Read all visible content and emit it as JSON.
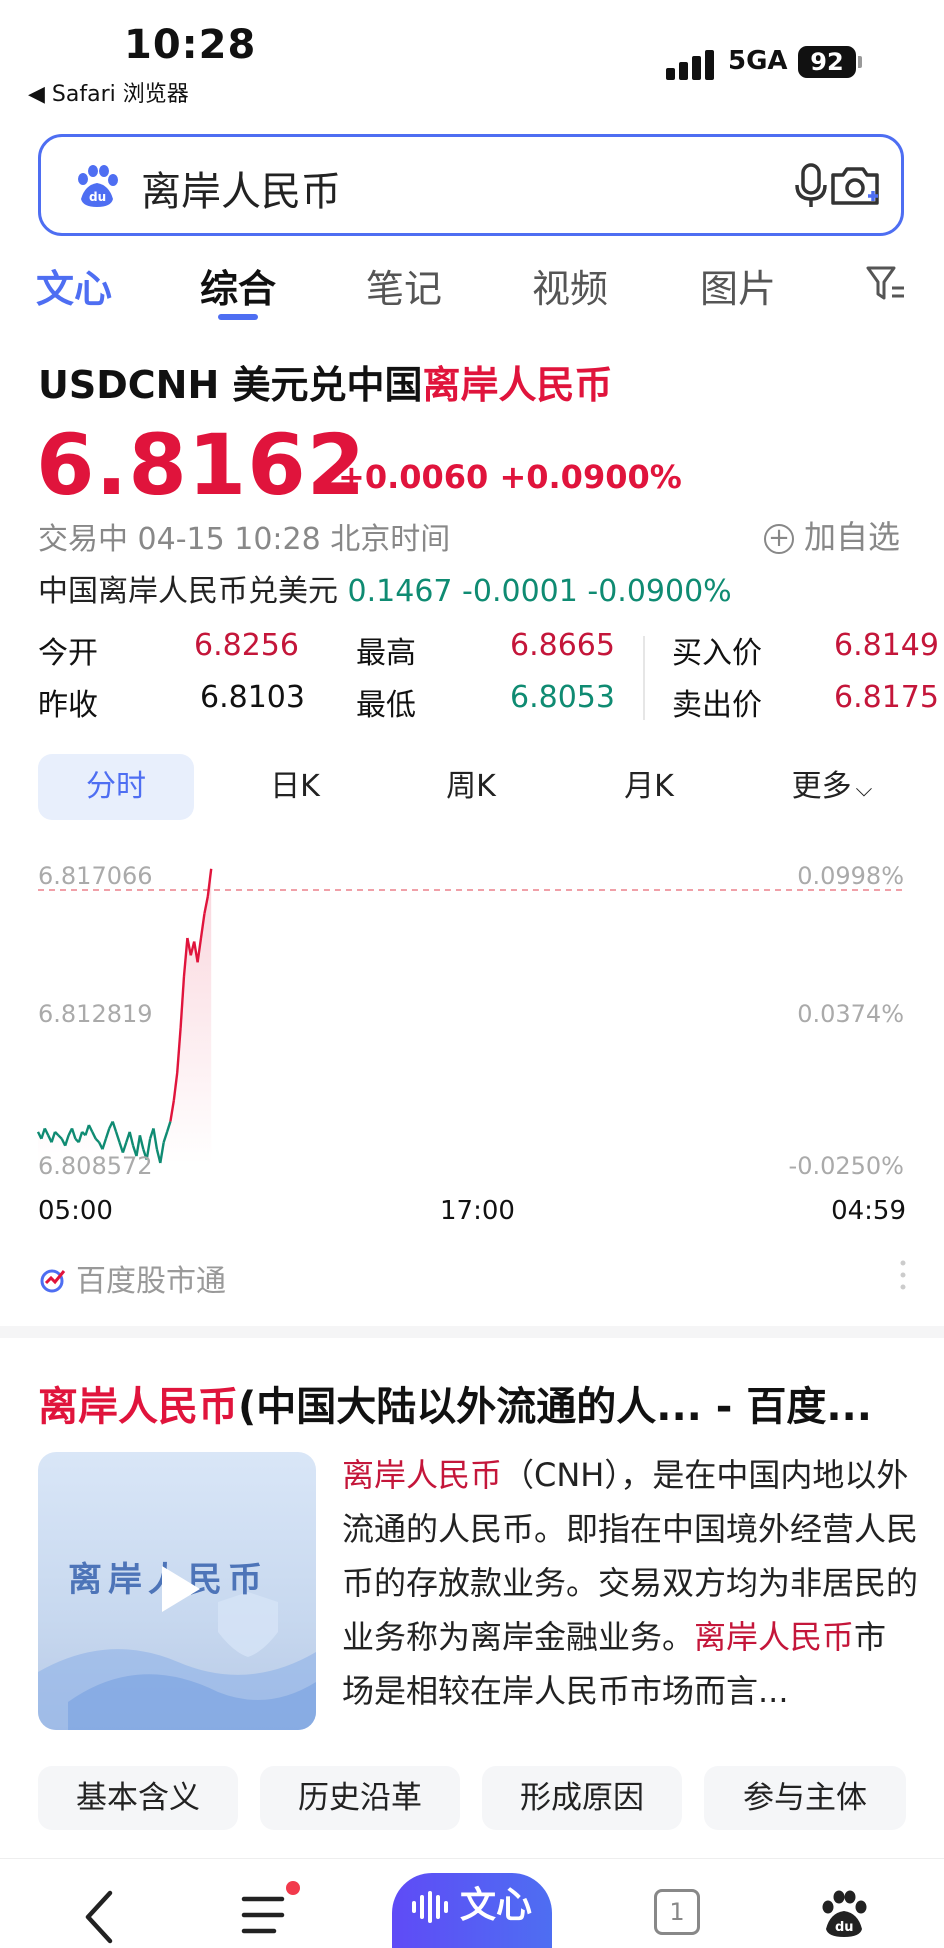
{
  "status_bar": {
    "time": "10:28",
    "back_app": "◀ Safari 浏览器",
    "network": "5GA",
    "battery": "92"
  },
  "search": {
    "query": "离岸人民币"
  },
  "tabs": [
    "文心",
    "综合",
    "笔记",
    "视频",
    "图片"
  ],
  "quote": {
    "title_prefix": "USDCNH 美元兑中国",
    "title_highlight": "离岸人民币",
    "price": "6.8162",
    "change": "+0.0060 +0.0900%",
    "trade_status": "交易中 04-15 10:28 北京时间",
    "add_watch": "加自选",
    "inverse_label": "中国离岸人民币兑美元",
    "inverse_values": "0.1467 -0.0001 -0.0900%",
    "stats": {
      "open_label": "今开",
      "open": "6.8256",
      "prev_label": "昨收",
      "prev": "6.8103",
      "high_label": "最高",
      "high": "6.8665",
      "low_label": "最低",
      "low": "6.8053",
      "bid_label": "买入价",
      "bid": "6.8149",
      "ask_label": "卖出价",
      "ask": "6.8175"
    }
  },
  "chart_tabs": [
    "分时",
    "日K",
    "周K",
    "月K",
    "更多"
  ],
  "chart_data": {
    "type": "line",
    "title": "",
    "ylabels_left": [
      "6.817066",
      "6.812819",
      "6.808572"
    ],
    "ylabels_right": [
      "0.0998%",
      "0.0374%",
      "-0.0250%"
    ],
    "xlabels": [
      "05:00",
      "17:00",
      "04:59"
    ],
    "ylim": [
      6.808572,
      6.817066
    ],
    "reference_price": 6.8103,
    "series": [
      {
        "values": [
          6.8095,
          6.8093,
          6.8096,
          6.8094,
          6.8092,
          6.8095,
          6.8094,
          6.8093,
          6.8091,
          6.8094,
          6.8096,
          6.8093,
          6.8092,
          6.8095,
          6.8094,
          6.8097,
          6.8095,
          6.8093,
          6.8092,
          6.809,
          6.8093,
          6.8096,
          6.8098,
          6.8095,
          6.8092,
          6.8089,
          6.8092,
          6.8095,
          6.8091,
          6.8088,
          6.8094,
          6.809,
          6.8087,
          6.8093,
          6.8096,
          6.809,
          6.8086,
          6.8092,
          6.8095,
          6.8098,
          6.8104,
          6.8112,
          6.8125,
          6.814,
          6.8151,
          6.8146,
          6.815,
          6.8144,
          6.8151,
          6.8158,
          6.8163,
          6.8171
        ]
      }
    ]
  },
  "source": "百度股市通",
  "result": {
    "title_highlight": "离岸人民币",
    "title_rest": "(中国大陆以外流通的人... - 百度...",
    "thumb_text": "离岸人民币",
    "desc_1_highlight": "离岸人民币",
    "desc_1": "（CNH），是在中国内地以外流通的人民币。即指在中国境外经营人民币的存放款业务。交易双方均为非居民的业务称为离岸金融业务。",
    "desc_2_highlight": "离岸人民币",
    "desc_2": "市场是相较在岸人民币市场而言..."
  },
  "chips": [
    "基本含义",
    "历史沿革",
    "形成原因",
    "参与主体"
  ],
  "bottom_bar": {
    "wenxin": "文心",
    "tab_count": "1"
  },
  "colors": {
    "accent": "#4e6ef2",
    "up": "#e0143c",
    "down": "#0f8b72"
  }
}
